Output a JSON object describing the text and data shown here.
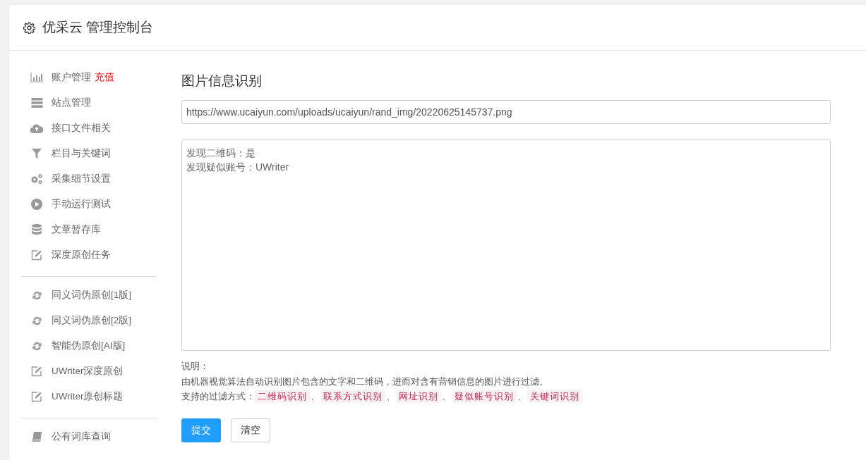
{
  "header": {
    "title": "优采云 管理控制台"
  },
  "sidebar": {
    "groups": [
      {
        "items": [
          {
            "label": "账户管理",
            "badge": "充值"
          },
          {
            "label": "站点管理"
          },
          {
            "label": "接口文件相关"
          },
          {
            "label": "栏目与关键词"
          },
          {
            "label": "采集细节设置"
          },
          {
            "label": "手动运行测试"
          },
          {
            "label": "文章暂存库"
          },
          {
            "label": "深度原创任务"
          }
        ]
      },
      {
        "items": [
          {
            "label": "同义词伪原创[1版]"
          },
          {
            "label": "同义词伪原创[2版]"
          },
          {
            "label": "智能伪原创[AI版]"
          },
          {
            "label": "UWriter深度原创"
          },
          {
            "label": "UWriter原创标题"
          }
        ]
      },
      {
        "items": [
          {
            "label": "公有词库查询"
          }
        ]
      }
    ]
  },
  "main": {
    "title": "图片信息识别",
    "url_field": {
      "value": "https://www.ucaiyun.com/uploads/ucaiyun/rand_img/20220625145737.png"
    },
    "result_box": {
      "lines": [
        "发现二维码：是",
        "发现疑似账号：UWriter"
      ]
    },
    "notes": {
      "heading": "说明：",
      "description": "由机器视觉算法自动识别图片包含的文字和二维码，进而对含有营销信息的图片进行过滤。",
      "filters_label": "支持的过滤方式：",
      "filters": [
        {
          "label": "二维码识别",
          "separator": "、"
        },
        {
          "label": "联系方式识别",
          "separator": "、"
        },
        {
          "label": "网址识别",
          "separator": "、"
        },
        {
          "label": "疑似账号识别",
          "separator": "、"
        },
        {
          "label": "关键词识别"
        }
      ]
    },
    "buttons": [
      {
        "label": "提交",
        "kind": "primary"
      },
      {
        "label": "清空",
        "kind": "default"
      }
    ]
  }
}
